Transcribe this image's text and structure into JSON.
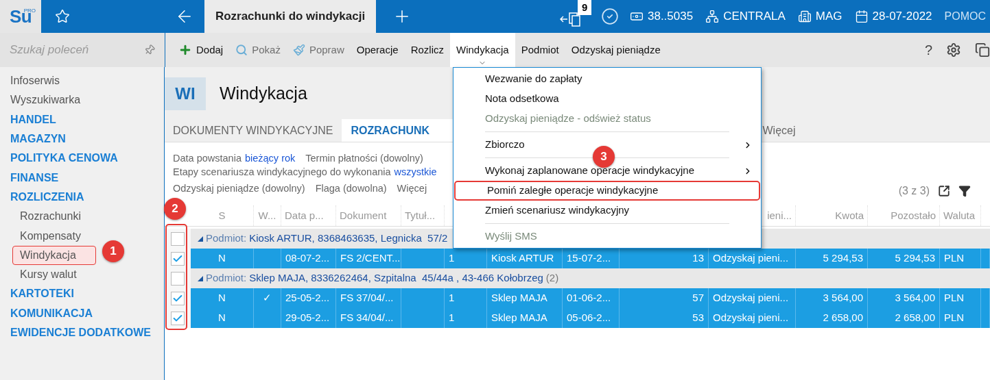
{
  "top_bar": {
    "logo": "Su",
    "logo_badge": "PRO",
    "tab_title": "Rozrachunki do windykacji",
    "notification_count": "9",
    "items": [
      {
        "kind": "company",
        "label": "38..5035"
      },
      {
        "kind": "branch",
        "label": "CENTRALA"
      },
      {
        "kind": "warehouse",
        "label": "MAG"
      },
      {
        "kind": "date",
        "label": "28-07-2022"
      }
    ],
    "help": "POMOC"
  },
  "sidebar": {
    "search_placeholder": "Szukaj poleceń",
    "items": [
      {
        "label": "Infoserwis",
        "kind": "link",
        "selected": false
      },
      {
        "label": "Wyszukiwarka",
        "kind": "link",
        "selected": false
      },
      {
        "label": "HANDEL",
        "kind": "section",
        "selected": false
      },
      {
        "label": "MAGAZYN",
        "kind": "section",
        "selected": false
      },
      {
        "label": "POLITYKA CENOWA",
        "kind": "section",
        "selected": false
      },
      {
        "label": "FINANSE",
        "kind": "section",
        "selected": false
      },
      {
        "label": "ROZLICZENIA",
        "kind": "section",
        "selected": false
      },
      {
        "label": "Rozrachunki",
        "kind": "subitem",
        "selected": false
      },
      {
        "label": "Kompensaty",
        "kind": "subitem",
        "selected": false
      },
      {
        "label": "Windykacja",
        "kind": "subitem",
        "selected": true
      },
      {
        "label": "Kursy walut",
        "kind": "subitem",
        "selected": false
      },
      {
        "label": "KARTOTEKI",
        "kind": "section",
        "selected": false
      },
      {
        "label": "KOMUNIKACJA",
        "kind": "section",
        "selected": false
      },
      {
        "label": "EWIDENCJE DODATKOWE",
        "kind": "section",
        "selected": false
      }
    ]
  },
  "toolbar": {
    "items": [
      {
        "label": "Dodaj",
        "disabled": false,
        "selected": false
      },
      {
        "label": "Pokaż",
        "disabled": true,
        "selected": false
      },
      {
        "label": "Popraw",
        "disabled": true,
        "selected": false
      },
      {
        "label": "Operacje",
        "disabled": false,
        "selected": false
      },
      {
        "label": "Rozlicz",
        "disabled": false,
        "selected": false
      },
      {
        "label": "Windykacja",
        "disabled": false,
        "selected": true
      },
      {
        "label": "Podmiot",
        "disabled": false,
        "selected": false
      },
      {
        "label": "Odzyskaj pieniądze",
        "disabled": false,
        "selected": false
      }
    ],
    "help": "?"
  },
  "module": {
    "code": "WI",
    "title": "Windykacja"
  },
  "tabs": [
    {
      "label": "DOKUMENTY WINDYKACYJNE",
      "selected": false
    },
    {
      "label": "ROZRACHUNK",
      "selected": true
    },
    {
      "label": "Więcej",
      "selected": false
    }
  ],
  "filters": [
    [
      {
        "kind": "label",
        "text": "Data powstania"
      },
      {
        "kind": "value",
        "text": "bieżący rok"
      },
      {
        "kind": "label",
        "text": "Termin płatności (dowolny)"
      }
    ],
    [
      {
        "kind": "label",
        "text": "Etapy scenariusza windykacyjnego do wykonania"
      },
      {
        "kind": "value",
        "text": "wszystkie"
      }
    ],
    [
      {
        "kind": "label",
        "text": "Odzyskaj pieniądze (dowolny)"
      },
      {
        "kind": "label",
        "text": "Flaga (dowolna)"
      },
      {
        "kind": "label",
        "text": "Więcej"
      }
    ]
  ],
  "record_count": "(3 z 3)",
  "table": {
    "columns": [
      "S",
      "W...",
      "Data p...",
      "Dokument",
      "Tytuł...",
      null,
      null,
      null,
      null,
      "ieni...",
      "Kwota",
      "Pozostało",
      "Waluta",
      null
    ],
    "rows": [
      {
        "kind": "group",
        "checked": false,
        "expanded": true,
        "label": "Podmiot:",
        "text": "Kiosk ARTUR, 8368463635, Legnicka  57/2"
      },
      {
        "kind": "data",
        "checked": true,
        "cells": [
          "N",
          null,
          "08-07-2...",
          "FS 2/CENT...",
          null,
          "1",
          "Kiosk ARTUR",
          "15-07-2...",
          "13",
          "Odzyskaj pieni...",
          "5 294,53",
          "5 294,53",
          "PLN",
          null
        ]
      },
      {
        "kind": "group",
        "checked": false,
        "expanded": true,
        "label": "Podmiot:",
        "text": "Sklep MAJA, 8336262464, Szpitalna  45/44a , 43-466 Kołobrzeg",
        "count": "(2)"
      },
      {
        "kind": "data",
        "checked": true,
        "cells": [
          "N",
          "✓",
          "25-05-2...",
          "FS 37/04/...",
          null,
          "1",
          "Sklep MAJA",
          "01-06-2...",
          "57",
          "Odzyskaj pieni...",
          "3 564,00",
          "3 564,00",
          "PLN",
          null
        ]
      },
      {
        "kind": "data",
        "checked": true,
        "cells": [
          "N",
          null,
          "29-05-2...",
          "FS 34/04/...",
          null,
          "1",
          "Sklep MAJA",
          "05-06-2...",
          "53",
          "Odzyskaj pieni...",
          "2 658,00",
          "2 658,00",
          "PLN",
          null
        ]
      }
    ]
  },
  "menu": {
    "items": [
      {
        "kind": "item",
        "label": "Wezwanie do zapłaty",
        "disabled": false,
        "submenu": false,
        "highlighted": false
      },
      {
        "kind": "item",
        "label": "Nota odsetkowa",
        "disabled": false,
        "submenu": false,
        "highlighted": false
      },
      {
        "kind": "item",
        "label": "Odzyskaj pieniądze - odśwież status",
        "disabled": true,
        "submenu": false,
        "highlighted": false
      },
      {
        "kind": "separator"
      },
      {
        "kind": "item",
        "label": "Zbiorczo",
        "disabled": false,
        "submenu": true,
        "highlighted": false
      },
      {
        "kind": "separator"
      },
      {
        "kind": "item",
        "label": "Wykonaj zaplanowane operacje windykacyjne",
        "disabled": false,
        "submenu": true,
        "highlighted": false
      },
      {
        "kind": "item",
        "label": "Pomiń zaległe operacje windykacyjne",
        "disabled": false,
        "submenu": false,
        "highlighted": true
      },
      {
        "kind": "item",
        "label": "Zmień scenariusz windykacyjny",
        "disabled": false,
        "submenu": false,
        "highlighted": false
      },
      {
        "kind": "separator"
      },
      {
        "kind": "item",
        "label": "Wyślij SMS",
        "disabled": true,
        "submenu": false,
        "highlighted": false
      }
    ]
  },
  "callouts": [
    "1",
    "2",
    "3"
  ]
}
